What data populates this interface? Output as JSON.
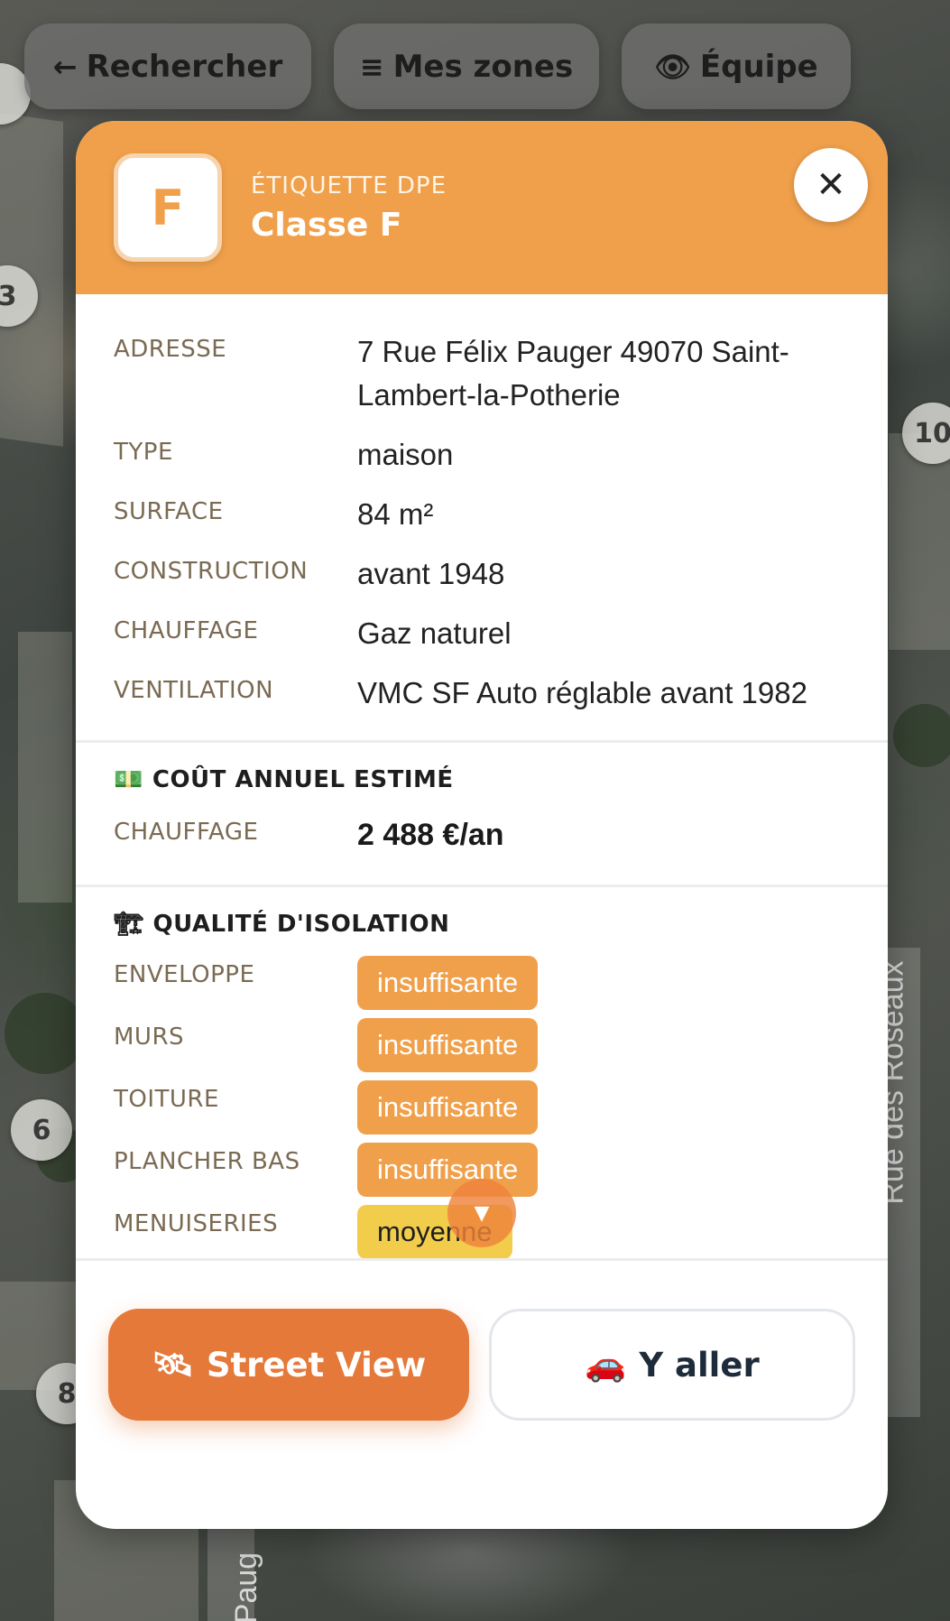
{
  "top_nav": {
    "search": {
      "icon": "arrow-left-icon",
      "label": "Rechercher"
    },
    "zones": {
      "icon": "menu-icon",
      "label": "Mes zones"
    },
    "team": {
      "icon": "eye-icon",
      "label": "Équipe"
    }
  },
  "map": {
    "markers": [
      "3",
      "10",
      "6",
      "8"
    ],
    "streets": [
      "Rue des Roseaux",
      "Paug"
    ]
  },
  "panel": {
    "header": {
      "grade_letter": "F",
      "kicker": "ÉTIQUETTE DPE",
      "title": "Classe F",
      "close_icon": "close-icon",
      "accent_color": "#f0a04b"
    },
    "details": [
      {
        "label": "ADRESSE",
        "value": "7 Rue Félix Pauger 49070 Saint-Lambert-la-Potherie"
      },
      {
        "label": "TYPE",
        "value": "maison"
      },
      {
        "label": "SURFACE",
        "value": "84 m²"
      },
      {
        "label": "CONSTRUCTION",
        "value": "avant 1948"
      },
      {
        "label": "CHAUFFAGE",
        "value": "Gaz naturel"
      },
      {
        "label": "VENTILATION",
        "value": "VMC SF Auto réglable avant 1982"
      }
    ],
    "cost": {
      "icon": "banknote-icon",
      "title": "COÛT ANNUEL ESTIMÉ",
      "label": "CHAUFFAGE",
      "value": "2 488 €/an"
    },
    "insulation": {
      "icon": "crane-icon",
      "title": "QUALITÉ D'ISOLATION",
      "items": [
        {
          "label": "ENVELOPPE",
          "value": "insuffisante",
          "color": "#f0a04b"
        },
        {
          "label": "MURS",
          "value": "insuffisante",
          "color": "#f0a04b"
        },
        {
          "label": "TOITURE",
          "value": "insuffisante",
          "color": "#f0a04b"
        },
        {
          "label": "PLANCHER BAS",
          "value": "insuffisante",
          "color": "#f0a04b"
        },
        {
          "label": "MENUISERIES",
          "value": "moyenne",
          "color": "#f2cd4c"
        }
      ]
    },
    "scroll_icon": "chevron-down-icon",
    "actions": {
      "street_view": {
        "icon": "satellite-icon",
        "label": "Street View",
        "color": "#e4793a"
      },
      "go": {
        "icon": "car-icon",
        "label": "Y aller"
      }
    }
  }
}
